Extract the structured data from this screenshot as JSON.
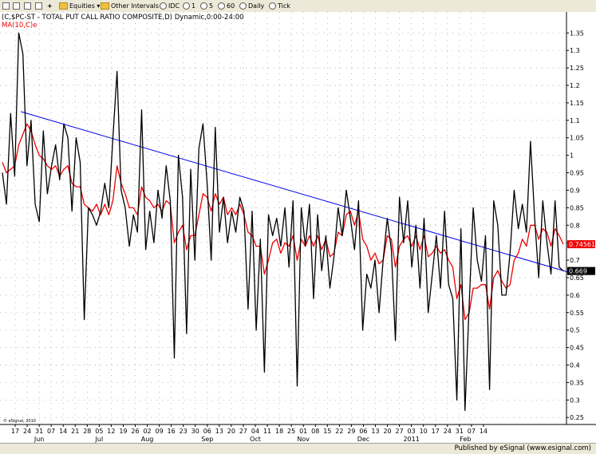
{
  "toolbar": {
    "equities": "Equities",
    "other_intervals": "Other Intervals",
    "idc": "IDC",
    "i1": "1",
    "i5": "5",
    "i60": "60",
    "daily": "Daily",
    "tick": "Tick"
  },
  "footer": {
    "text": "Published by eSignal (www.esignal.com)"
  },
  "chart_data": {
    "type": "line",
    "title": "(C,$PC-ST - TOTAL PUT CALL RATIO COMPOSITE,D) Dynamic,0:00-24:00",
    "ma_label": "MA(10,C)e",
    "copyright": "© eSignal, 2010",
    "ylim": [
      0.23,
      1.41
    ],
    "yticks": [
      0.25,
      0.3,
      0.35,
      0.4,
      0.45,
      0.5,
      0.55,
      0.6,
      0.65,
      0.7,
      0.75,
      0.8,
      0.85,
      0.9,
      0.95,
      1,
      1.05,
      1.1,
      1.15,
      1.2,
      1.25,
      1.3,
      1.35
    ],
    "ytick_labels": [
      "0.25",
      "0.3",
      "0.35",
      "0.4",
      "0.45",
      "0.5",
      "0.55",
      "0.6",
      "0.65",
      "0.7",
      "0.75",
      "0.8",
      "0.85",
      "0.9",
      "0.95",
      "1",
      "1.05",
      "1.1",
      "1.15",
      "1.2",
      "1.25",
      "1.3",
      "1.35"
    ],
    "xticks": [
      "17",
      "24",
      "31",
      "07",
      "14",
      "21",
      "28",
      "05",
      "12",
      "19",
      "26",
      "02",
      "09",
      "16",
      "23",
      "30",
      "06",
      "13",
      "20",
      "27",
      "04",
      "11",
      "18",
      "25",
      "01",
      "08",
      "15",
      "22",
      "29",
      "06",
      "13",
      "20",
      "27",
      "03",
      "10",
      "17",
      "24",
      "31",
      "07",
      "14"
    ],
    "months": [
      {
        "label": "Jun",
        "tick": 2
      },
      {
        "label": "Jul",
        "tick": 7
      },
      {
        "label": "Aug",
        "tick": 11
      },
      {
        "label": "Sep",
        "tick": 16
      },
      {
        "label": "Oct",
        "tick": 20
      },
      {
        "label": "Nov",
        "tick": 24
      },
      {
        "label": "Dec",
        "tick": 29
      },
      {
        "label": "2011",
        "tick": 33
      },
      {
        "label": "Feb",
        "tick": 37.5
      }
    ],
    "series": [
      {
        "name": "$PC-ST",
        "color": "#000000",
        "values": [
          0.95,
          0.86,
          1.12,
          0.94,
          1.35,
          1.29,
          0.97,
          1.1,
          0.86,
          0.81,
          1.07,
          0.89,
          0.97,
          1.03,
          0.93,
          1.09,
          1.05,
          0.84,
          1.05,
          0.98,
          0.53,
          0.85,
          0.83,
          0.8,
          0.84,
          0.92,
          0.85,
          1.05,
          1.24,
          0.9,
          0.85,
          0.74,
          0.83,
          0.78,
          1.13,
          0.73,
          0.84,
          0.75,
          0.9,
          0.82,
          0.97,
          0.87,
          0.42,
          1.0,
          0.88,
          0.49,
          0.96,
          0.7,
          1.02,
          1.09,
          0.92,
          0.7,
          1.08,
          0.78,
          0.88,
          0.75,
          0.84,
          0.78,
          0.88,
          0.84,
          0.56,
          0.84,
          0.5,
          0.76,
          0.38,
          0.83,
          0.77,
          0.82,
          0.74,
          0.85,
          0.68,
          0.87,
          0.34,
          0.85,
          0.74,
          0.86,
          0.59,
          0.83,
          0.67,
          0.77,
          0.62,
          0.71,
          0.85,
          0.77,
          0.9,
          0.82,
          0.73,
          0.87,
          0.5,
          0.66,
          0.62,
          0.7,
          0.55,
          0.7,
          0.82,
          0.73,
          0.47,
          0.88,
          0.75,
          0.87,
          0.68,
          0.8,
          0.62,
          0.82,
          0.55,
          0.66,
          0.77,
          0.62,
          0.84,
          0.63,
          0.59,
          0.3,
          0.79,
          0.27,
          0.57,
          0.85,
          0.7,
          0.64,
          0.77,
          0.33,
          0.87,
          0.8,
          0.6,
          0.6,
          0.72,
          0.9,
          0.79,
          0.86,
          0.78,
          1.04,
          0.82,
          0.65,
          0.87,
          0.75,
          0.66,
          0.87,
          0.68,
          0.669
        ],
        "last_label": "0.669"
      },
      {
        "name": "MA(10,C)e",
        "color": "#ee0000",
        "values": [
          0.98,
          0.95,
          0.96,
          0.97,
          1.03,
          1.06,
          1.09,
          1.07,
          1.03,
          1.0,
          0.99,
          0.97,
          0.96,
          0.97,
          0.94,
          0.96,
          0.97,
          0.92,
          0.91,
          0.91,
          0.86,
          0.85,
          0.84,
          0.86,
          0.83,
          0.86,
          0.83,
          0.87,
          0.97,
          0.92,
          0.89,
          0.85,
          0.85,
          0.83,
          0.91,
          0.88,
          0.87,
          0.85,
          0.86,
          0.84,
          0.87,
          0.86,
          0.75,
          0.78,
          0.8,
          0.73,
          0.77,
          0.77,
          0.83,
          0.89,
          0.88,
          0.84,
          0.89,
          0.86,
          0.88,
          0.83,
          0.85,
          0.83,
          0.86,
          0.83,
          0.78,
          0.77,
          0.74,
          0.74,
          0.66,
          0.7,
          0.75,
          0.76,
          0.72,
          0.75,
          0.74,
          0.77,
          0.7,
          0.76,
          0.74,
          0.77,
          0.74,
          0.77,
          0.73,
          0.76,
          0.71,
          0.72,
          0.78,
          0.77,
          0.83,
          0.84,
          0.8,
          0.84,
          0.76,
          0.74,
          0.7,
          0.72,
          0.69,
          0.7,
          0.77,
          0.76,
          0.68,
          0.74,
          0.76,
          0.77,
          0.74,
          0.77,
          0.73,
          0.77,
          0.71,
          0.72,
          0.74,
          0.72,
          0.73,
          0.7,
          0.68,
          0.59,
          0.63,
          0.53,
          0.55,
          0.62,
          0.62,
          0.63,
          0.63,
          0.56,
          0.65,
          0.67,
          0.64,
          0.62,
          0.63,
          0.7,
          0.72,
          0.76,
          0.74,
          0.8,
          0.8,
          0.76,
          0.79,
          0.78,
          0.74,
          0.79,
          0.77,
          0.745615
        ],
        "last_label": "0.745615"
      }
    ],
    "trendline": {
      "color": "#0000ee",
      "from": {
        "index": 4.5,
        "value": 1.125
      },
      "to": {
        "index": 139,
        "value": 0.663
      }
    },
    "grid": true
  }
}
